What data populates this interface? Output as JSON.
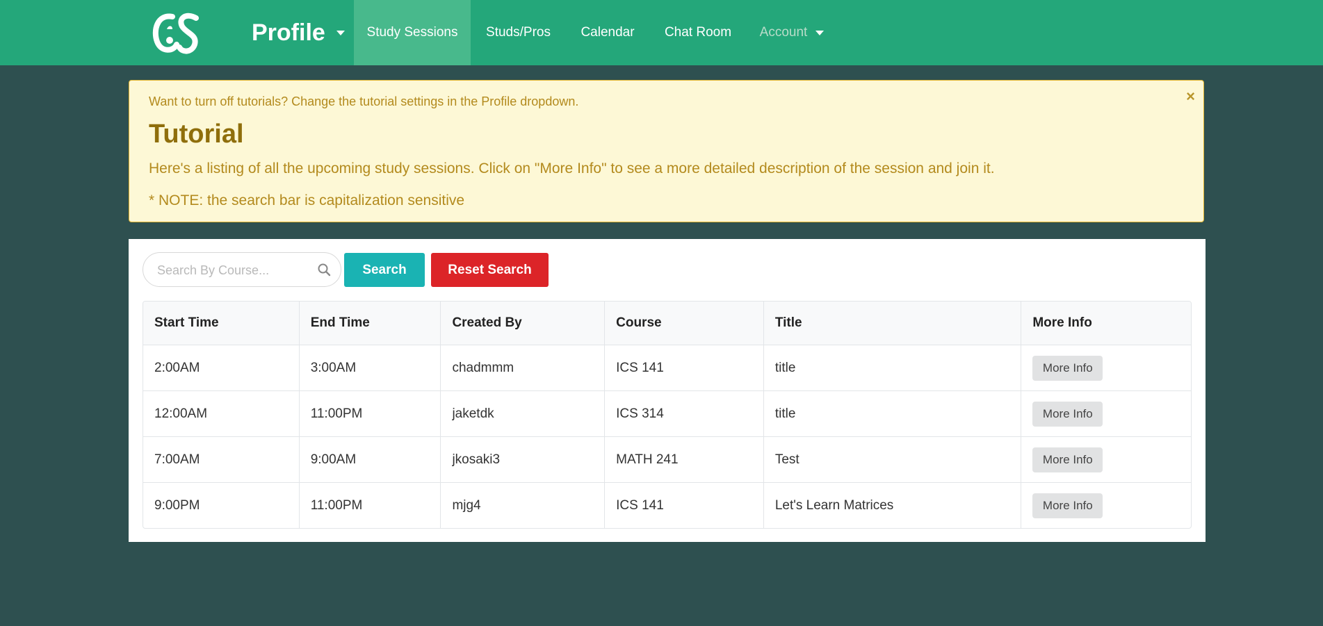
{
  "navbar": {
    "logo_text": "CS",
    "profile_label": "Profile",
    "items": [
      {
        "label": "Study Sessions",
        "active": true
      },
      {
        "label": "Studs/Pros"
      },
      {
        "label": "Calendar"
      },
      {
        "label": "Chat Room"
      }
    ],
    "account_label": "Account"
  },
  "alert": {
    "note": "Want to turn off tutorials? Change the tutorial settings in the Profile dropdown.",
    "title": "Tutorial",
    "description": "Here's a listing of all the upcoming study sessions. Click on \"More Info\" to see a more detailed description of the session and join it.",
    "search_note": "* NOTE: the search bar is capitalization sensitive",
    "close_symbol": "×"
  },
  "search": {
    "placeholder": "Search By Course...",
    "value": "",
    "search_label": "Search",
    "reset_label": "Reset Search"
  },
  "table": {
    "headers": [
      "Start Time",
      "End Time",
      "Created By",
      "Course",
      "Title",
      "More Info"
    ],
    "more_info_label": "More Info",
    "rows": [
      {
        "start": "2:00AM",
        "end": "3:00AM",
        "creator": "chadmmm",
        "course": "ICS 141",
        "title": "title"
      },
      {
        "start": "12:00AM",
        "end": "11:00PM",
        "creator": "jaketdk",
        "course": "ICS 314",
        "title": "title"
      },
      {
        "start": "7:00AM",
        "end": "9:00AM",
        "creator": "jkosaki3",
        "course": "MATH 241",
        "title": "Test"
      },
      {
        "start": "9:00PM",
        "end": "11:00PM",
        "creator": "mjg4",
        "course": "ICS 141",
        "title": "Let's Learn Matrices"
      }
    ]
  },
  "colors": {
    "navbar": "#24a77a",
    "navbar_active": "#48b98c",
    "background": "#2e5050",
    "alert_bg": "#fdf8d6",
    "alert_border": "#e2b42c",
    "search_button": "#1ab3b3",
    "reset_button": "#dc2428"
  },
  "icons": {
    "search": "search-icon",
    "close": "close-icon",
    "dropdown": "caret-down-icon",
    "logo": "cs-logo"
  }
}
